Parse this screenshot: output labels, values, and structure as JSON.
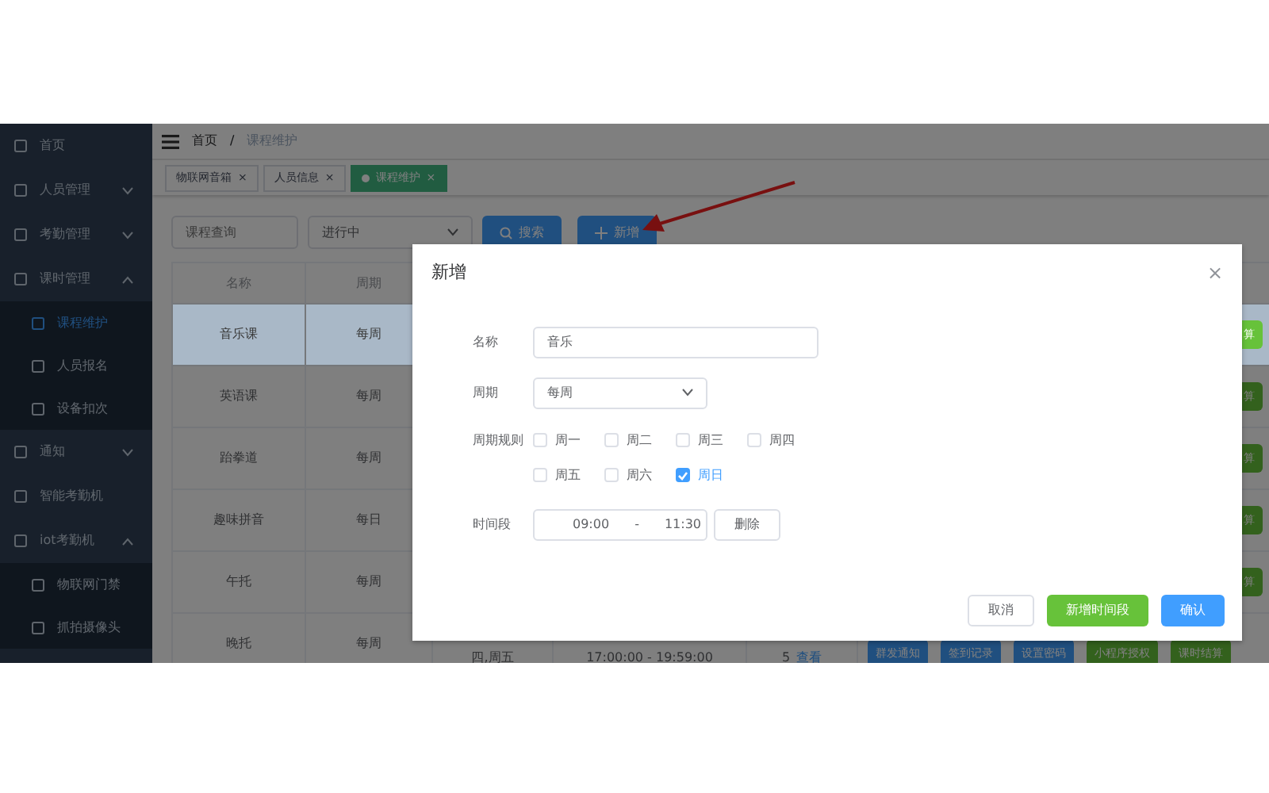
{
  "sidebar": {
    "items": [
      {
        "label": "首页",
        "selected": false
      },
      {
        "label": "人员管理",
        "selected": false,
        "expanded": false
      },
      {
        "label": "考勤管理",
        "selected": false,
        "expanded": false
      },
      {
        "label": "课时管理",
        "selected": false,
        "expanded": true,
        "children": [
          {
            "label": "课程维护",
            "selected": true
          },
          {
            "label": "人员报名",
            "selected": false
          },
          {
            "label": "设备扣次",
            "selected": false
          }
        ]
      },
      {
        "label": "通知",
        "selected": false,
        "expanded": false
      },
      {
        "label": "智能考勤机",
        "selected": false
      },
      {
        "label": "iot考勤机",
        "selected": false,
        "expanded": true,
        "children": [
          {
            "label": "物联网门禁",
            "selected": false
          },
          {
            "label": "抓拍摄像头",
            "selected": false
          }
        ]
      }
    ]
  },
  "breadcrumb": {
    "items": [
      "首页",
      "课程维护"
    ],
    "separator": "/"
  },
  "tags": [
    {
      "label": "物联网音箱",
      "selected": false,
      "close": "×"
    },
    {
      "label": "人员信息",
      "selected": false,
      "close": "×"
    },
    {
      "label": "课程维护",
      "selected": true,
      "close": "×"
    }
  ],
  "filters": {
    "search": {
      "placeholder": "课程查询"
    },
    "status": {
      "value": "进行中"
    },
    "search_button": "搜索",
    "add_button": "新增"
  },
  "table": {
    "columns": [
      "名称",
      "周期"
    ],
    "rows": [
      {
        "cells": [
          "音乐课",
          "每周"
        ],
        "selected": true,
        "action": "算"
      },
      {
        "cells": [
          "英语课",
          "每周"
        ],
        "selected": false,
        "action": "算"
      },
      {
        "cells": [
          "跆拳道",
          "每周"
        ],
        "selected": false,
        "action": "算"
      },
      {
        "cells": [
          "趣味拼音",
          "每日"
        ],
        "selected": false,
        "action": "算"
      },
      {
        "cells": [
          "午托",
          "每周"
        ],
        "selected": false,
        "action": "算"
      },
      {
        "cells": [
          "晚托",
          "每周",
          "四,周五",
          "17:00:00 - 19:59:00",
          "5"
        ],
        "selected": false,
        "link": "查看",
        "buttons": [
          {
            "label": "群发通知",
            "kind": "primary"
          },
          {
            "label": "签到记录",
            "kind": "primary"
          },
          {
            "label": "设置密码",
            "kind": "primary"
          },
          {
            "label": "小程序授权",
            "kind": "success"
          },
          {
            "label": "课时结算",
            "kind": "success"
          }
        ]
      }
    ]
  },
  "dialog": {
    "title": "新增",
    "close": "×",
    "name": {
      "label": "名称",
      "value": "音乐"
    },
    "period": {
      "label": "周期",
      "value": "每周"
    },
    "rule": {
      "label": "周期规则",
      "days": [
        {
          "label": "周一",
          "checked": false
        },
        {
          "label": "周二",
          "checked": false
        },
        {
          "label": "周三",
          "checked": false
        },
        {
          "label": "周四",
          "checked": false
        },
        {
          "label": "周五",
          "checked": false
        },
        {
          "label": "周六",
          "checked": false
        },
        {
          "label": "周日",
          "checked": true
        }
      ]
    },
    "time": {
      "label": "时间段",
      "start": "09:00",
      "separator": "-",
      "end": "11:30",
      "delete": "删除"
    },
    "buttons": {
      "cancel": "取消",
      "add": "新增时间段",
      "confirm": "确认"
    }
  }
}
